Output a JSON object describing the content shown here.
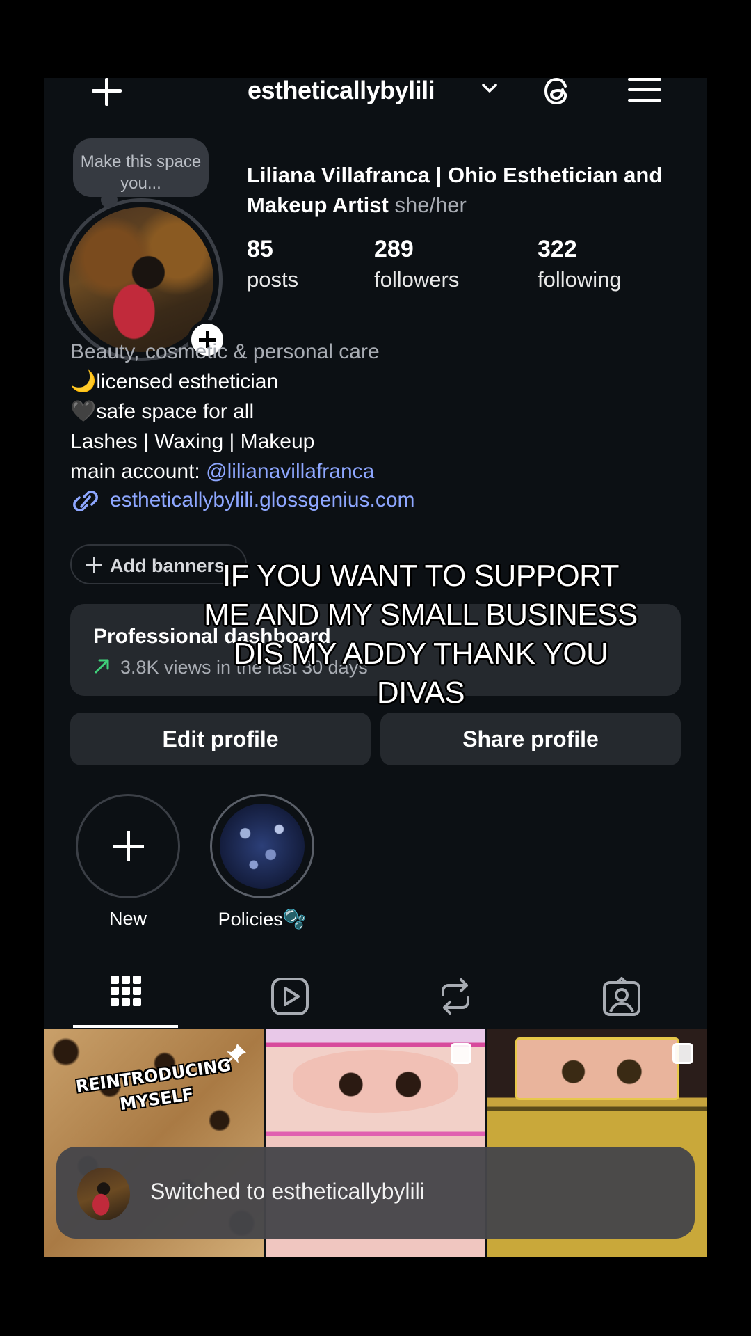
{
  "topbar": {
    "username": "estheticallybylili",
    "icons": [
      "plus-icon",
      "chevron-down-icon",
      "threads-icon",
      "menu-icon"
    ]
  },
  "profile": {
    "note": "Make this space you...",
    "display_name": "Liliana Villafranca | Ohio Esthetician and Makeup Artist",
    "pronouns": "she/her",
    "stats": [
      {
        "value": "85",
        "label": "posts"
      },
      {
        "value": "289",
        "label": "followers"
      },
      {
        "value": "322",
        "label": "following"
      }
    ]
  },
  "bio": {
    "category": "Beauty, cosmetic & personal care",
    "line1": "🌙licensed esthetician",
    "line2": "🖤safe space for all",
    "line3": "Lashes | Waxing | Makeup",
    "line4_prefix": "main account: ",
    "line4_mention": "@lilianavillafranca",
    "link": "estheticallybylili.glossgenius.com"
  },
  "add_banners": "Add banners",
  "dashboard": {
    "title": "Professional dashboard",
    "subtitle": "3.8K views in the last 30 days"
  },
  "buttons": {
    "edit": "Edit profile",
    "share": "Share profile"
  },
  "highlights": [
    {
      "label": "New"
    },
    {
      "label": "Policies🫧"
    }
  ],
  "tabs": [
    "grid-icon",
    "reels-icon",
    "reposts-icon",
    "tagged-icon"
  ],
  "posts": [
    {
      "title": "REINTRODUCING MYSELF",
      "pinned": true
    },
    {
      "carousel": true
    },
    {
      "carousel": true
    }
  ],
  "overlay_caption": "IF YOU WANT TO SUPPORT ME AND MY SMALL BUSINESS DIS MY ADDY THANK YOU DIVAS",
  "toast": {
    "text": "Switched to estheticallybylili"
  },
  "colors": {
    "background": "#0c1014",
    "card": "#25292e",
    "link": "#8ea7ff",
    "secondary_text": "#a8acb3"
  }
}
